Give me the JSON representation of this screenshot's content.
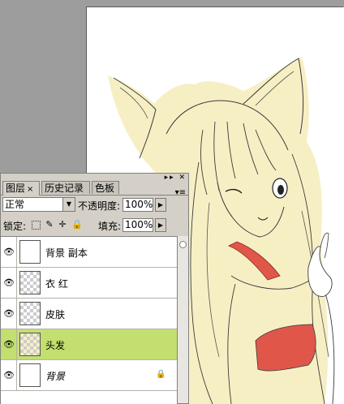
{
  "panel": {
    "tabs": [
      {
        "label": "图层",
        "active": true
      },
      {
        "label": "历史记录",
        "active": false
      },
      {
        "label": "色板",
        "active": false
      }
    ],
    "tab_close": "×",
    "blend_mode": "正常",
    "opacity_label": "不透明度:",
    "opacity_value": "100%",
    "lock_label": "锁定:",
    "fill_label": "填充:",
    "fill_value": "100%"
  },
  "layers": [
    {
      "name": "背景 副本",
      "visible": true,
      "selected": false,
      "italic": false,
      "locked": false
    },
    {
      "name": "衣 红",
      "visible": true,
      "selected": false,
      "italic": false,
      "locked": false
    },
    {
      "name": "皮肤",
      "visible": true,
      "selected": false,
      "italic": false,
      "locked": false
    },
    {
      "name": "头发",
      "visible": true,
      "selected": true,
      "italic": false,
      "locked": false
    },
    {
      "name": "背景",
      "visible": true,
      "selected": false,
      "italic": true,
      "locked": true
    }
  ],
  "colors": {
    "selected_layer": "#c3df6f",
    "hair_fill": "#f7efc4",
    "scarf_red": "#e0574a",
    "canvas_gray": "#9d9d9d"
  }
}
